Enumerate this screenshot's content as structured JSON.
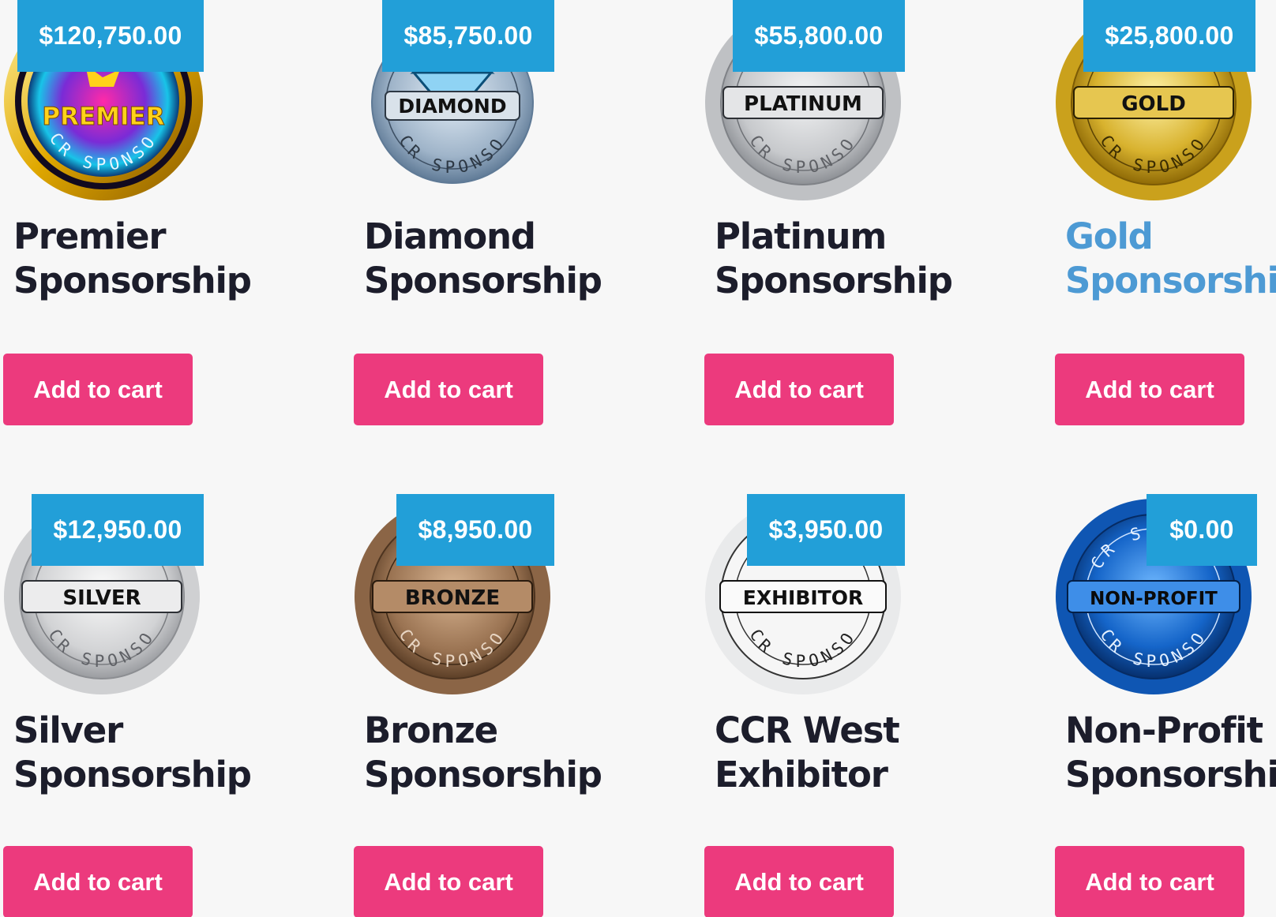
{
  "products": [
    {
      "price": "$120,750.00",
      "title1": "Premier",
      "title2": "Sponsorship",
      "seal": "PREMIER",
      "ring": "PREMIER SPONSOR",
      "arc": "CCR SPONSOR",
      "cart": "Add to cart",
      "color": "#e8b800",
      "icon": "premier-seal-icon"
    },
    {
      "price": "$85,750.00",
      "title1": "Diamond",
      "title2": "Sponsorship",
      "seal": "DIAMOND",
      "arc": "CCR SPONSOR",
      "cart": "Add to cart",
      "color": "#9fb4c9",
      "icon": "diamond-seal-icon"
    },
    {
      "price": "$55,800.00",
      "title1": "Platinum",
      "title2": "Sponsorship",
      "seal": "PLATINUM",
      "arc": "CCR SPONSOR",
      "cart": "Add to cart",
      "color": "#c7c9cc",
      "icon": "platinum-seal-icon"
    },
    {
      "price": "$25,800.00",
      "title1": "Gold",
      "title2": "Sponsorship",
      "seal": "GOLD",
      "arc": "CCR SPONSOR",
      "cart": "Add to cart",
      "color": "#d8b22e",
      "icon": "gold-seal-icon"
    },
    {
      "price": "$12,950.00",
      "title1": "Silver",
      "title2": "Sponsorship",
      "seal": "SILVER",
      "arc": "CCR SPONSOR",
      "cart": "Add to cart",
      "color": "#d2d3d5",
      "icon": "silver-seal-icon"
    },
    {
      "price": "$8,950.00",
      "title1": "Bronze",
      "title2": "Sponsorship",
      "seal": "BRONZE",
      "arc": "CCR SPONSOR",
      "cart": "Add to cart",
      "color": "#9a7352",
      "icon": "bronze-seal-icon"
    },
    {
      "price": "$3,950.00",
      "title1": "CCR West",
      "title2": "Exhibitor",
      "seal": "EXHIBITOR",
      "arc": "CCR SPONSOR",
      "cart": "Add to cart",
      "color": "#f2f2f2",
      "icon": "exhibitor-seal-icon"
    },
    {
      "price": "$0.00",
      "title1": "Non-Profit",
      "title2": "Sponsorship",
      "seal": "NON-PROFIT",
      "arc": "CCR SPONSOR",
      "cart": "Add to cart",
      "color": "#1565c9",
      "icon": "non-profit-seal-icon"
    }
  ],
  "colors": {
    "price_bg": "#229fd8",
    "cart_bg": "#ec3a7d",
    "title": "#1c1d2b",
    "title_hover": "#4d9ad4"
  }
}
